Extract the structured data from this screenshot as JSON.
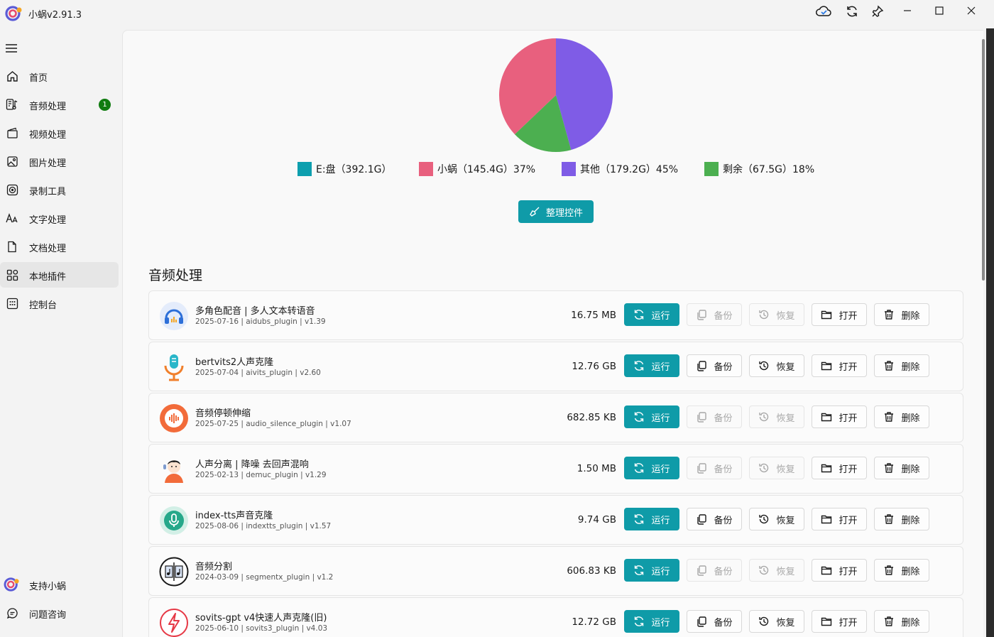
{
  "app": {
    "title": "小蜗v2.91.3"
  },
  "sidebar": {
    "items": [
      {
        "label": "首页",
        "icon": "home-icon"
      },
      {
        "label": "音频处理",
        "icon": "audio-icon",
        "badge": "1"
      },
      {
        "label": "视频处理",
        "icon": "video-icon"
      },
      {
        "label": "图片处理",
        "icon": "image-icon"
      },
      {
        "label": "录制工具",
        "icon": "record-icon"
      },
      {
        "label": "文字处理",
        "icon": "text-icon"
      },
      {
        "label": "文档处理",
        "icon": "document-icon"
      },
      {
        "label": "本地插件",
        "icon": "plugins-icon",
        "active": true
      },
      {
        "label": "控制台",
        "icon": "console-icon"
      }
    ],
    "bottom": [
      {
        "label": "支持小蜗",
        "icon": "support-logo-icon"
      },
      {
        "label": "问题咨询",
        "icon": "chat-icon"
      }
    ]
  },
  "disk": {
    "legend": [
      {
        "label": "E:盘（392.1G）",
        "color": "#0d9fae"
      },
      {
        "label": "小蜗（145.4G）37%",
        "color": "#e8607e"
      },
      {
        "label": "其他（179.2G）45%",
        "color": "#7f5ce6"
      },
      {
        "label": "剩余（67.5G）18%",
        "color": "#4caf50"
      }
    ],
    "tidy_button": "整理控件"
  },
  "chart_data": {
    "type": "pie",
    "title": "",
    "slices": [
      {
        "name": "小蜗",
        "value": 145.4,
        "percent": 37,
        "color": "#e8607e"
      },
      {
        "name": "其他",
        "value": 179.2,
        "percent": 45,
        "color": "#7f5ce6"
      },
      {
        "name": "剩余",
        "value": 67.5,
        "percent": 18,
        "color": "#4caf50"
      }
    ]
  },
  "section": {
    "title": "音频处理"
  },
  "buttons": {
    "run": "运行",
    "backup": "备份",
    "restore": "恢复",
    "open": "打开",
    "delete": "删除"
  },
  "plugins": [
    {
      "name": "多角色配音 | 多人文本转语音",
      "meta": "2025-07-16 | aidubs_plugin | v1.39",
      "size": "16.75 MB",
      "backup_enabled": false,
      "restore_enabled": false,
      "icon": "headphones-icon"
    },
    {
      "name": "bertvits2人声克隆",
      "meta": "2025-07-04 | aivits_plugin | v2.60",
      "size": "12.76 GB",
      "backup_enabled": true,
      "restore_enabled": true,
      "icon": "microphone-icon"
    },
    {
      "name": "音频停顿伸缩",
      "meta": "2025-07-25 | audio_silence_plugin | v1.07",
      "size": "682.85 KB",
      "backup_enabled": false,
      "restore_enabled": false,
      "icon": "waveform-icon"
    },
    {
      "name": "人声分离 | 降噪 去回声混响",
      "meta": "2025-02-13 | demuc_plugin | v1.29",
      "size": "1.50 MB",
      "backup_enabled": false,
      "restore_enabled": false,
      "icon": "person-avatar-icon"
    },
    {
      "name": "index-tts声音克隆",
      "meta": "2025-08-06 | indextts_plugin | v1.57",
      "size": "9.74 GB",
      "backup_enabled": true,
      "restore_enabled": true,
      "icon": "mic-circle-icon"
    },
    {
      "name": "音频分割",
      "meta": "2024-03-09 | segmentx_plugin | v1.2",
      "size": "606.83 KB",
      "backup_enabled": false,
      "restore_enabled": false,
      "icon": "audio-split-icon"
    },
    {
      "name": "sovits-gpt v4快速人声克隆(旧)",
      "meta": "2025-06-10 | sovits3_plugin | v4.03",
      "size": "12.72 GB",
      "backup_enabled": true,
      "restore_enabled": true,
      "icon": "lightning-circle-icon"
    }
  ]
}
